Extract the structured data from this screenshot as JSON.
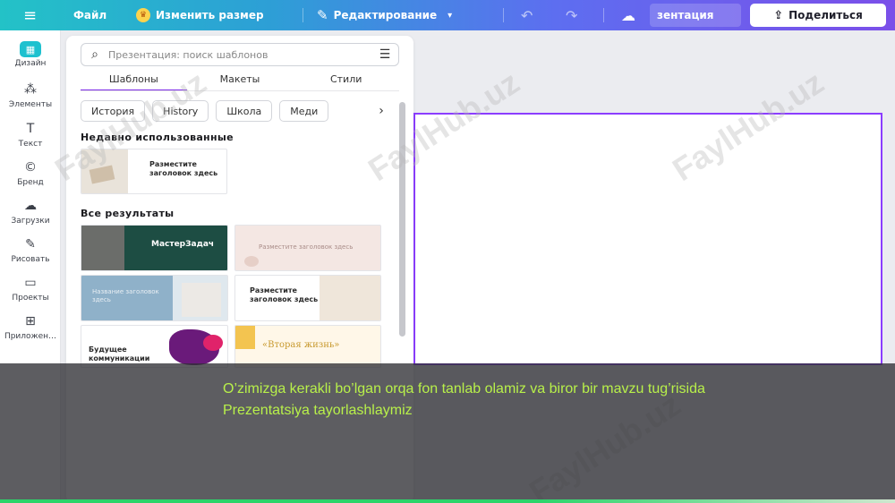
{
  "topbar": {
    "file": "Файл",
    "resize": "Изменить размер",
    "edit": "Редактирование",
    "present": "зентация",
    "share": "Поделиться"
  },
  "rail": [
    {
      "label": "Дизайн",
      "icon": "design-icon",
      "glyph": "▦"
    },
    {
      "label": "Элементы",
      "icon": "elements-icon",
      "glyph": "⁂"
    },
    {
      "label": "Текст",
      "icon": "text-icon",
      "glyph": "T"
    },
    {
      "label": "Бренд",
      "icon": "brand-icon",
      "glyph": "©"
    },
    {
      "label": "Загрузки",
      "icon": "upload-icon",
      "glyph": "☁"
    },
    {
      "label": "Рисовать",
      "icon": "draw-icon",
      "glyph": "✎"
    },
    {
      "label": "Проекты",
      "icon": "folder-icon",
      "glyph": "▭"
    },
    {
      "label": "Приложен…",
      "icon": "apps-icon",
      "glyph": "⊞"
    }
  ],
  "panel": {
    "search_placeholder": "Презентация: поиск шаблонов",
    "tabs": [
      "Шаблоны",
      "Макеты",
      "Стили"
    ],
    "chips": [
      "История",
      "History",
      "Школа",
      "Меди"
    ],
    "recent_title": "Недавно использованные",
    "all_title": "Все результаты",
    "recent_card_text": "Разместите заголовок здесь",
    "cards": {
      "c1": "МастерЗадач",
      "c2": "Разместите заголовок здесь",
      "c3": "Название заголовок здесь",
      "c4": "Разместите заголовок здесь",
      "c5": "Будущее коммуникации",
      "c6": "«Вторая жизнь»"
    }
  },
  "caption": "O’zimizga kerakli bo’lgan orqa fon tanlab olamiz va biror bir mavzu tug’risida Prezentatsiya tayorlashlaymiz",
  "watermark": "FaylHub.uz",
  "colors": {
    "accent": "#8b3dff",
    "caption": "#b8f04a",
    "design_active": "#1ec1cf"
  }
}
